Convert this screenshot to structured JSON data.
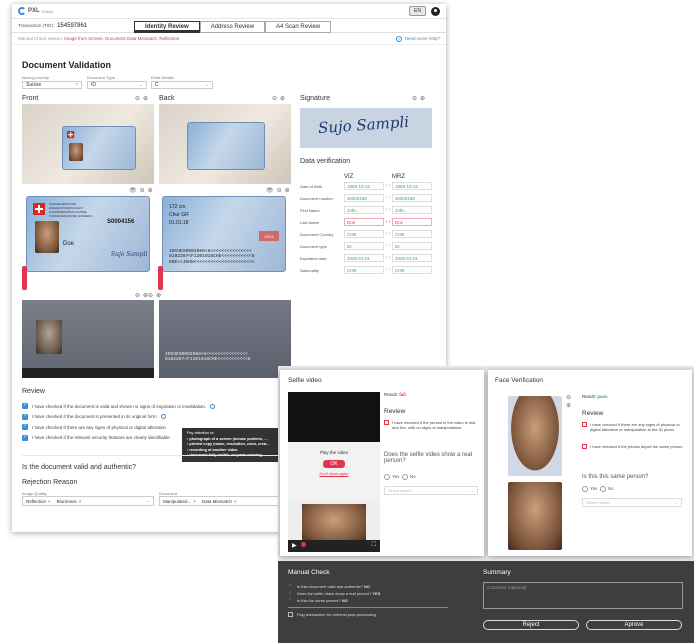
{
  "app": {
    "logo": "PXL",
    "logo_sub": "Check",
    "language": "EN"
  },
  "transaction": {
    "label": "Transaction (TID):",
    "id": "154597861"
  },
  "tabs": [
    {
      "label": "Identity Review",
      "active": true
    },
    {
      "label": "Address Review",
      "active": false
    },
    {
      "label": "A4 Scan Review",
      "active": false
    }
  ],
  "manual_check_bar": {
    "prefix": "Manual Check reason:",
    "reason": "Image from Screen, Document Data Mismatch, Reflection",
    "help": "Need some help?"
  },
  "document_validation": {
    "title": "Document Validation",
    "issuing_country": {
      "label": "Issuing country",
      "value": "Suïsse"
    },
    "document_type": {
      "label": "Document Type",
      "value": "ID"
    },
    "extra_details": {
      "label": "Extra Details",
      "value": "C"
    },
    "front_label": "Front",
    "back_label": "Back"
  },
  "id_card": {
    "number": "S0004156",
    "front_mrz": [
      "IDCHES0002068<6<<<<<<<<<<<<<<<",
      "8102287<F1301016CHE<<<<<<<<<<<6",
      "DOE<<JOHN<<<<<<<<<<<<<<<<<<<<<<"
    ],
    "back_texts": [
      "172 cm",
      "Chur GR",
      "01.01.18",
      "2013"
    ],
    "front_name": "Doe",
    "signature_text": "Sujo Sampli"
  },
  "signature": {
    "label": "Signature",
    "text": "Sujo Sampli"
  },
  "data_verification": {
    "title": "Data verification",
    "col_viz": "VIZ",
    "col_mrz": "MRZ",
    "rows": [
      {
        "label": "Date of Birth",
        "viz": "1968-10-12",
        "mrz": "1968-10-12",
        "mismatch": false
      },
      {
        "label": "Document number",
        "viz": "s0004156",
        "mrz": "s0004156",
        "mismatch": false
      },
      {
        "label": "First Name",
        "viz": "John",
        "mrz": "John",
        "mismatch": false
      },
      {
        "label": "Last Name",
        "viz": "Doe",
        "mrz": "Doc",
        "mismatch": true
      },
      {
        "label": "Document Country",
        "viz": "CHE",
        "mrz": "CHE",
        "mismatch": false
      },
      {
        "label": "Document type",
        "viz": "ID",
        "mrz": "ID",
        "mismatch": false
      },
      {
        "label": "Expiration date",
        "viz": "2026-01-01",
        "mrz": "2026-01-01",
        "mismatch": false
      },
      {
        "label": "Nationality",
        "viz": "CHE",
        "mrz": "CHE",
        "mismatch": false
      }
    ]
  },
  "review": {
    "title": "Review",
    "items": [
      "I have checked if the document is valid and shows no signs of expiration or invalidation.",
      "I have checked if the document is presented in its original form",
      "I have checked if there are any signs of physical or digital alteration",
      "I have checked if the relevant security features are clearly identifiable"
    ]
  },
  "tooltip": {
    "title": "Pay attention to:",
    "items": [
      "photograph of a screen (mouse pointers, ...",
      "printed copy (noise, resolution, color, crea...",
      "recording of another video",
      "document fully visible, no parts missing, ..."
    ]
  },
  "validity_question": "Is the document valid and authentic?",
  "rejection": {
    "title": "Rejection Reason",
    "image_quality_label": "Image Quality",
    "image_quality_tags": [
      "Reflection",
      "Blurriness"
    ],
    "document_label": "Document",
    "document_tags": [
      "Manipulated...",
      "Data Mismatch"
    ]
  },
  "selfie": {
    "title": "Selfie video",
    "result_label": "Result:",
    "result_value": "fail",
    "result_color": "#e0344f",
    "review_title": "Review",
    "review_item": "I have checked if the person in the video is real and live, with no signs of manipulations",
    "play_label": "Play the video",
    "ok_label": "OK",
    "dont_show": "Don't show again",
    "question": "Does the selfie video show a real person?",
    "yes": "Yes",
    "no": "No",
    "select_placeholder": "Select reason"
  },
  "face": {
    "title": "Face Verification",
    "result_label": "Result:",
    "result_value": "pass",
    "result_color": "#3aa65a",
    "review_title": "Review",
    "items": [
      "I have checked if there are any signs of physical or digital alteration or manipulation to the ID photo",
      "I have checked if the photos depict the same person"
    ],
    "question": "Is this this same person?",
    "yes": "Yes",
    "no": "No",
    "select_placeholder": "Select reason"
  },
  "manual_check": {
    "title": "Manual Check",
    "lines": [
      {
        "icon": "cross",
        "text": "Is this document valid and authentic?",
        "answer": "NO"
      },
      {
        "icon": "check",
        "text": "Does the selfie video show a real person?",
        "answer": "YES"
      },
      {
        "icon": "cross",
        "text": "Is this the same person?",
        "answer": "NO"
      }
    ],
    "flag": "Flag transaction for external post-processing"
  },
  "summary": {
    "title": "Summary",
    "placeholder": "Comment (optional)",
    "reject": "Reject",
    "approve": "Aprove"
  },
  "colors": {
    "accent": "#3a8ed8",
    "error": "#e0344f",
    "success": "#3aa65a",
    "brand_pink": "#d03760"
  }
}
